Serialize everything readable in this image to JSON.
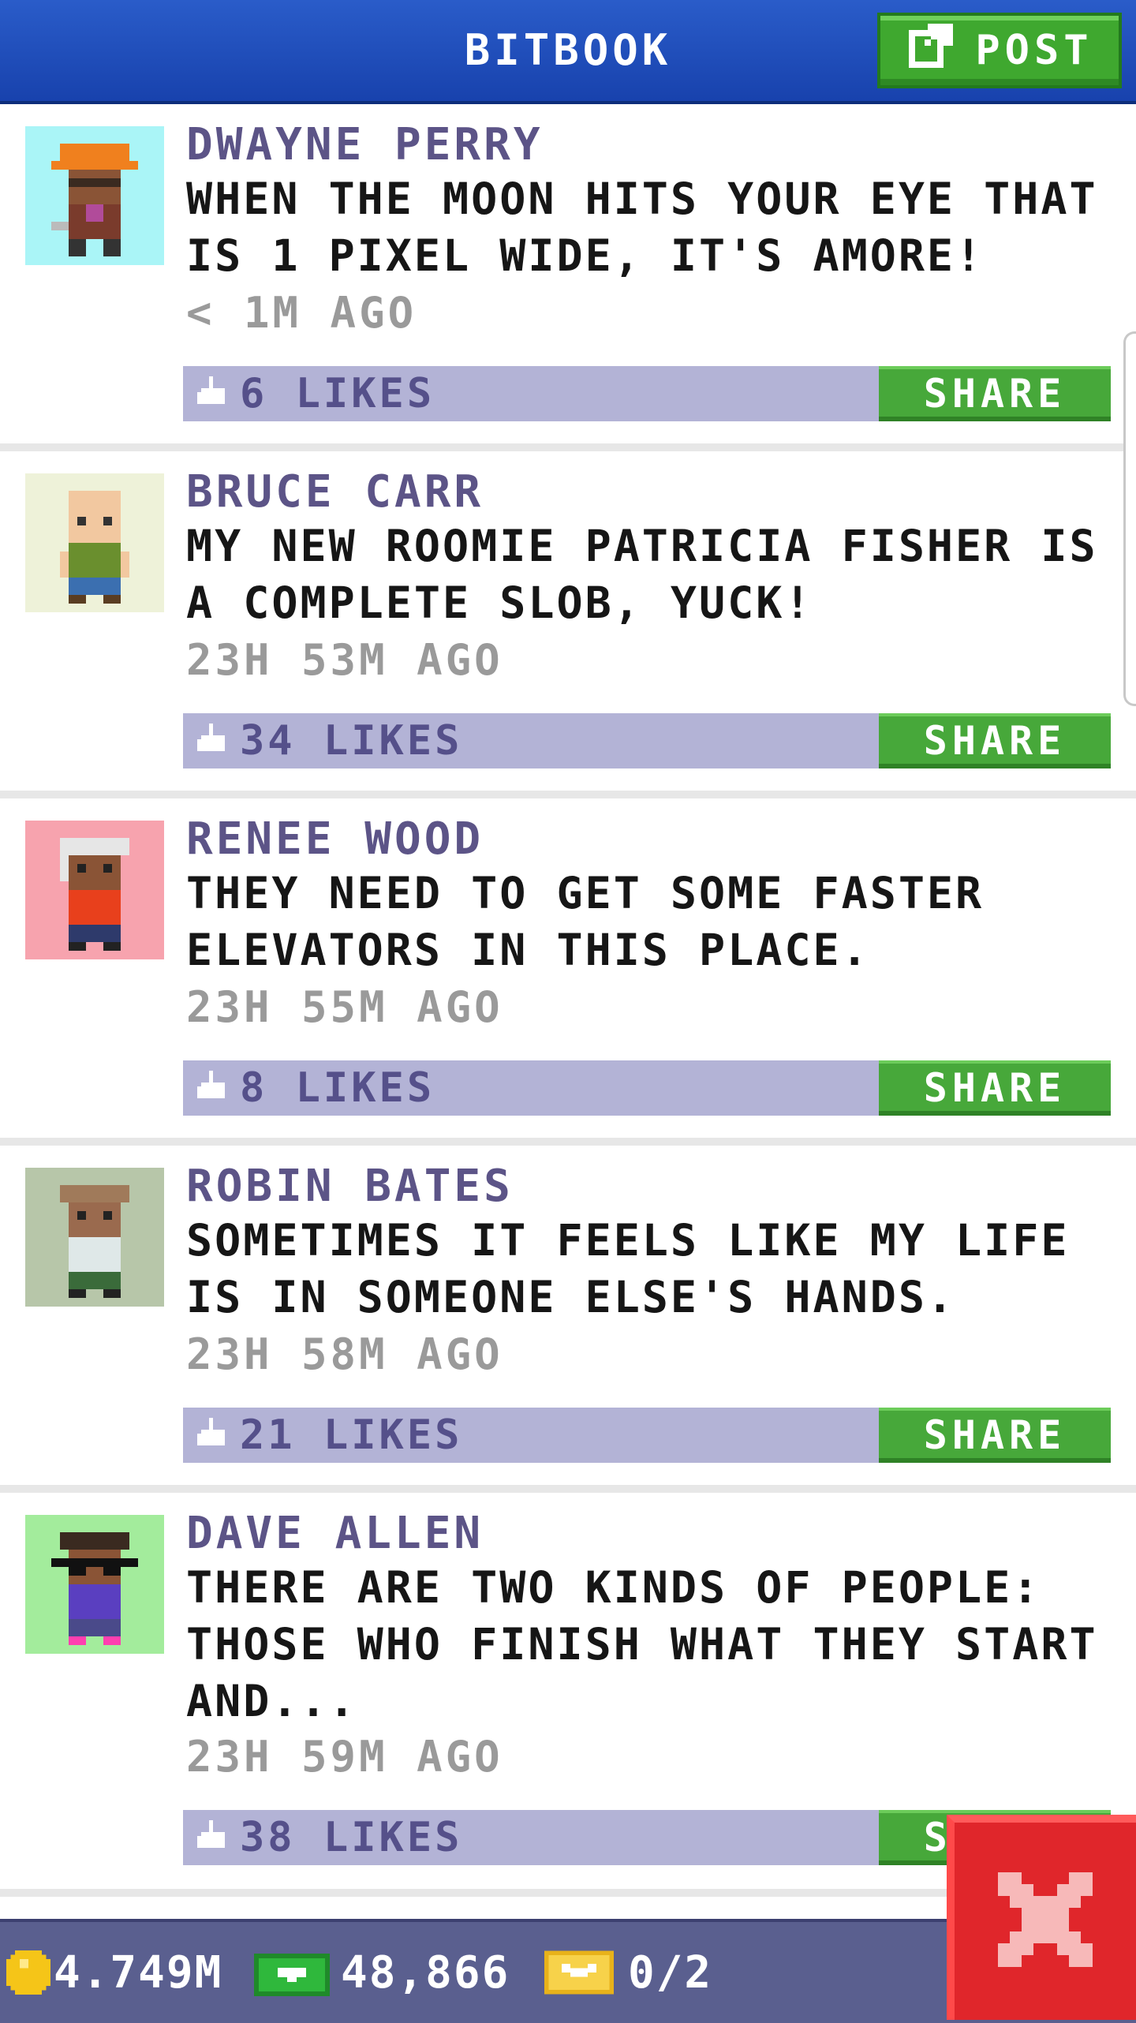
{
  "header": {
    "title": "BITBOOK",
    "post_label": "POST",
    "post_icon": "compose-icon"
  },
  "colors": {
    "header_blue": "#1f4fbf",
    "button_green": "#3fa82f",
    "like_bar": "#b3b3d6",
    "author_purple": "#5c5487",
    "close_red": "#e0262b",
    "status_bar": "#5a5f8f"
  },
  "posts": [
    {
      "author": "DWAYNE PERRY",
      "message": "WHEN THE MOON HITS YOUR EYE THAT IS 1 PIXEL WIDE, IT'S AMORE!",
      "time": "< 1M AGO",
      "likes": "6 LIKES",
      "share": "SHARE",
      "avatar_bg": "#aaf5f7"
    },
    {
      "author": "BRUCE CARR",
      "message": "MY NEW ROOMIE PATRICIA FISHER IS A COMPLETE SLOB, YUCK!",
      "time": "23H 53M AGO",
      "likes": "34 LIKES",
      "share": "SHARE",
      "avatar_bg": "#eef2d9"
    },
    {
      "author": "RENEE WOOD",
      "message": "THEY NEED TO GET SOME FASTER ELEVATORS IN THIS PLACE.",
      "time": "23H 55M AGO",
      "likes": "8 LIKES",
      "share": "SHARE",
      "avatar_bg": "#f7a3ae"
    },
    {
      "author": "ROBIN BATES",
      "message": "SOMETIMES IT FEELS LIKE MY LIFE IS IN SOMEONE ELSE'S HANDS.",
      "time": "23H 58M AGO",
      "likes": "21 LIKES",
      "share": "SHARE",
      "avatar_bg": "#b7c6a9"
    },
    {
      "author": "DAVE ALLEN",
      "message": "THERE ARE TWO KINDS OF PEOPLE: THOSE WHO FINISH WHAT THEY START AND...",
      "time": "23H 59M AGO",
      "likes": "38 LIKES",
      "share": "SHARE",
      "avatar_bg": "#a3ec9c"
    }
  ],
  "status": {
    "coins": "4.749M",
    "bux": "48,866",
    "tickets": "0/2"
  }
}
